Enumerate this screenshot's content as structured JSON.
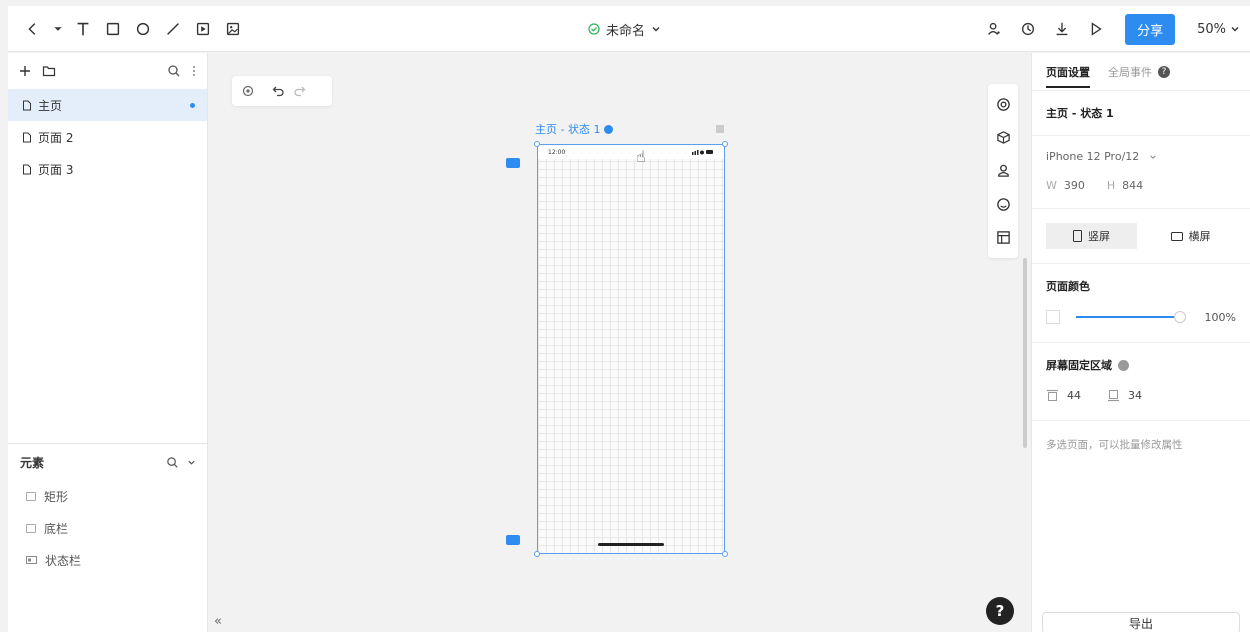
{
  "toolbar": {
    "doc_title": "未命名",
    "share_label": "分享",
    "zoom": "50%"
  },
  "left_panel": {
    "pages": [
      {
        "label": "主页"
      },
      {
        "label": "页面 2"
      },
      {
        "label": "页面 3"
      }
    ],
    "elements_title": "元素",
    "elements": [
      {
        "label": "矩形"
      },
      {
        "label": "底栏"
      },
      {
        "label": "状态栏"
      }
    ],
    "collapse_symbol": "«"
  },
  "canvas": {
    "frame_label": "主页 - 状态 1",
    "status_time": "12:00",
    "help_symbol": "?"
  },
  "right_panel": {
    "tab_page_settings": "页面设置",
    "tab_global_events": "全局事件",
    "current_state": "主页 - 状态 1",
    "device": "iPhone 12 Pro/12",
    "width_label": "W",
    "width": "390",
    "height_label": "H",
    "height": "844",
    "portrait": "竖屏",
    "landscape": "横屏",
    "page_color_title": "页面颜色",
    "opacity": "100%",
    "fixed_area_title": "屏幕固定区域",
    "top_fixed": "44",
    "bottom_fixed": "34",
    "hint": "多选页面，可以批量修改属性",
    "export_label": "导出"
  }
}
